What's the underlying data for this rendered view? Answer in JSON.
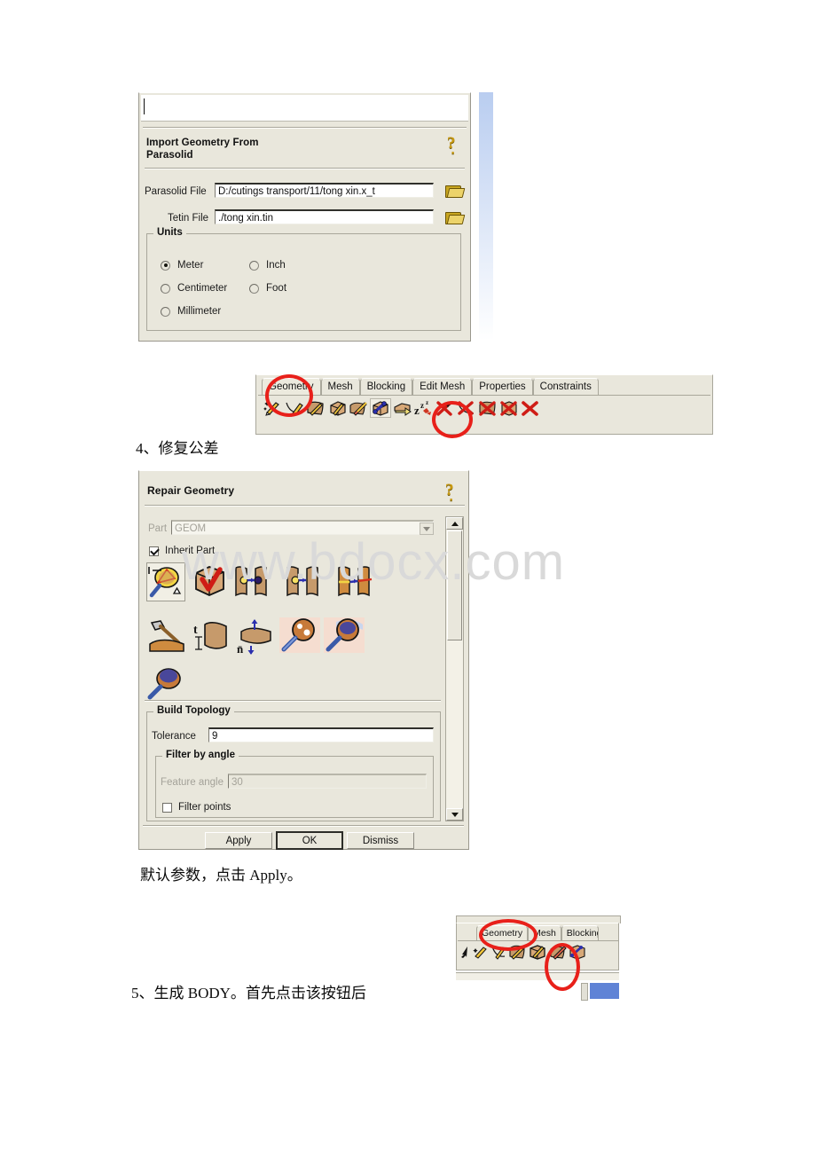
{
  "watermark": "www.bdocx.com",
  "import_dialog": {
    "title_line1": "Import Geometry From",
    "title_line2": "Parasolid",
    "help_icon": "help-question-icon",
    "fields": [
      {
        "label": "Parasolid File",
        "value": "D:/cutings transport/11/tong xin.x_t",
        "browse_icon": "folder-open-icon"
      },
      {
        "label": "Tetin File",
        "value": "./tong xin.tin",
        "browse_icon": "folder-open-icon"
      }
    ],
    "units_group_label": "Units",
    "units": [
      {
        "label": "Meter",
        "selected": true
      },
      {
        "label": "Inch",
        "selected": false
      },
      {
        "label": "Centimeter",
        "selected": false
      },
      {
        "label": "Foot",
        "selected": false
      },
      {
        "label": "Millimeter",
        "selected": false
      }
    ]
  },
  "toolbar_main": {
    "tabs": [
      {
        "label": "Geometry",
        "selected": true
      },
      {
        "label": "Mesh",
        "selected": false
      },
      {
        "label": "Blocking",
        "selected": false
      },
      {
        "label": "Edit Mesh",
        "selected": false
      },
      {
        "label": "Properties",
        "selected": false
      },
      {
        "label": "Constraints",
        "selected": false
      }
    ],
    "icons": [
      "create-point-icon",
      "create-curve-icon",
      "create-surface-icon",
      "create-body-icon",
      "create-block-icon",
      "repair-geometry-icon",
      "transform-geometry-icon",
      "restore-dormant-icon",
      "delete-point-icon",
      "delete-curve-icon",
      "delete-surface-icon",
      "delete-body-icon",
      "delete-any-icon"
    ],
    "selected_icon_index": 5
  },
  "repair_dialog": {
    "title": "Repair Geometry",
    "help_icon": "help-question-icon",
    "part": {
      "label": "Part",
      "value": "GEOM",
      "dropdown_icon": "chevron-down-icon",
      "disabled": true
    },
    "inherit_part": {
      "label": "Inherit Part",
      "checked": true
    },
    "tool_icons": [
      "build-diagnostic-topology-icon",
      "build-topology-icon",
      "close-holes-icon",
      "match-edges-icon",
      "stitch-edges-icon",
      "repair-edges-icon",
      "modify-surface-icon",
      "adjust-thickness-icon",
      "adjust-normals-icon",
      "find-surface-icon",
      "inspect-surface-icon",
      "check-geometry-icon"
    ],
    "build_topology": {
      "group_label": "Build Topology",
      "tolerance_label": "Tolerance",
      "tolerance_value": "9",
      "filter_group_label": "Filter by angle",
      "feature_angle_label": "Feature angle",
      "feature_angle_value": "30",
      "filter_points": {
        "label": "Filter points",
        "checked": false
      }
    },
    "buttons": [
      {
        "label": "Apply",
        "default": false
      },
      {
        "label": "OK",
        "default": true
      },
      {
        "label": "Dismiss",
        "default": false
      }
    ],
    "scrollbar": {
      "up_icon": "scroll-up-arrow-icon",
      "down_icon": "scroll-down-arrow-icon"
    }
  },
  "toolbar_small": {
    "tabs": [
      {
        "label": "Geometry",
        "selected": true
      },
      {
        "label": "Mesh",
        "selected": false
      },
      {
        "label": "Blocking",
        "selected": false
      }
    ],
    "icons": [
      "cursor-arrow-icon",
      "create-point-icon",
      "create-curve-icon",
      "create-surface-icon",
      "create-body-icon",
      "create-block-icon",
      "repair-geometry-icon"
    ],
    "highlighted_icon_index": 4
  },
  "captions": {
    "step4": "4、修复公差",
    "note_apply": "默认参数，点击 Apply。",
    "step5": "5、生成 BODY。首先点击该按钮后"
  },
  "colors": {
    "annotation_red": "#e8201a",
    "dialog_bg": "#e9e7dc",
    "field_bg": "#ffffff",
    "watermark_gray": "#d9d9d9",
    "accent_blue": "#b9cdf0"
  }
}
